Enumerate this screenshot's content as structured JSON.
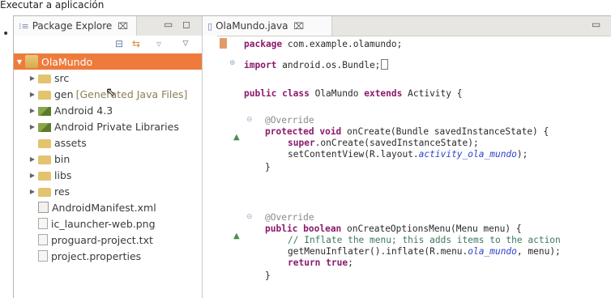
{
  "caption": "Executar a aplicación",
  "package_explorer": {
    "title": "Package Explore",
    "tree": [
      {
        "label": "OlaMundo",
        "icon": "android-project-icon",
        "selected": true,
        "indent": 0
      },
      {
        "label": "src",
        "icon": "source-folder-icon",
        "indent": 1
      },
      {
        "label": "gen",
        "decoration": "[Generated Java Files]",
        "icon": "gen-folder-icon",
        "indent": 1
      },
      {
        "label": "Android 4.3",
        "icon": "library-icon",
        "indent": 1
      },
      {
        "label": "Android Private Libraries",
        "icon": "library-icon",
        "indent": 1
      },
      {
        "label": "assets",
        "icon": "folder-icon",
        "indent": 1
      },
      {
        "label": "bin",
        "icon": "folder-icon",
        "indent": 1
      },
      {
        "label": "libs",
        "icon": "folder-icon",
        "indent": 1
      },
      {
        "label": "res",
        "icon": "folder-icon",
        "indent": 1
      },
      {
        "label": "AndroidManifest.xml",
        "icon": "xml-file-icon",
        "indent": 1
      },
      {
        "label": "ic_launcher-web.png",
        "icon": "image-file-icon",
        "indent": 1
      },
      {
        "label": "proguard-project.txt",
        "icon": "text-file-icon",
        "indent": 1
      },
      {
        "label": "project.properties",
        "icon": "text-file-icon",
        "indent": 1
      }
    ]
  },
  "editor": {
    "tab_title": "OlaMundo.java",
    "code": {
      "package_kw": "package",
      "package_name": "com.example.olamundo;",
      "import_kw": "import",
      "import_name": "android.os.Bundle;",
      "class_public": "public class",
      "class_name": "OlaMundo",
      "extends_kw": "extends",
      "class_rest": "Activity {",
      "override1": "@Override",
      "m1_kw": "protected void",
      "m1_sig": "onCreate(Bundle savedInstanceState) {",
      "m1_super_kw": "super",
      "m1_super_rest": ".onCreate(savedInstanceState);",
      "m1_set": "setContentView(R.layout.",
      "m1_set_it": "activity_ola_mundo",
      "m1_set_end": ");",
      "brace1": "}",
      "override2": "@Override",
      "m2_kw": "public boolean",
      "m2_sig": "onCreateOptionsMenu(Menu menu) {",
      "m2_comment": "// Inflate the menu; this adds items to the action",
      "m2_inflate": "getMenuInflater().inflate(R.menu.",
      "m2_inflate_it": "ola_mundo",
      "m2_inflate_end": ", menu);",
      "m2_return_kw": "return true",
      "m2_return_end": ";",
      "brace2": "}"
    }
  }
}
